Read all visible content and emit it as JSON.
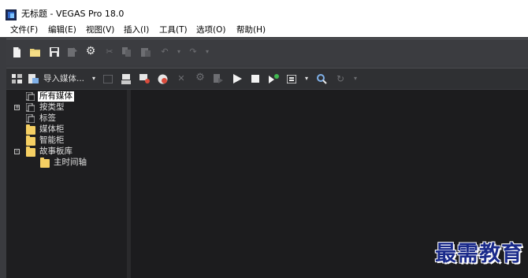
{
  "window": {
    "title": "无标题 - VEGAS Pro 18.0",
    "icon": "vegas-app-icon"
  },
  "menu": [
    {
      "label": "文件(F)"
    },
    {
      "label": "编辑(E)"
    },
    {
      "label": "视图(V)"
    },
    {
      "label": "插入(I)"
    },
    {
      "label": "工具(T)"
    },
    {
      "label": "选项(O)"
    },
    {
      "label": "帮助(H)"
    }
  ],
  "toolbar": {
    "icons": [
      "new-file-icon",
      "open-folder-icon",
      "save-icon",
      "render-as-icon",
      "properties-gear-icon",
      "cut-icon",
      "copy-icon",
      "paste-icon",
      "undo-icon",
      "undo-dropdown-icon",
      "redo-icon",
      "redo-dropdown-icon"
    ]
  },
  "media_toolbar": {
    "import_label": "导入媒体...",
    "icons": [
      "media-view-icon",
      "import-media-icon",
      "import-dropdown-icon",
      "capture-icon",
      "get-media-icon",
      "burn-disc-icon",
      "online-media-icon",
      "remove-icon",
      "effects-icon",
      "apply-media-fx-icon",
      "play-icon",
      "stop-icon",
      "auto-preview-icon",
      "views-icon",
      "views-dropdown-icon",
      "search-media-icon",
      "refresh-icon",
      "refresh-dropdown-icon"
    ]
  },
  "media_tree": {
    "items": [
      {
        "label": "所有媒体",
        "selected": true,
        "icon": "bin-icon"
      },
      {
        "label": "按类型",
        "expander": "+",
        "icon": "bin-icon"
      },
      {
        "label": "标签",
        "icon": "bin-icon"
      },
      {
        "label": "媒体柜",
        "icon": "folder-icon"
      },
      {
        "label": "智能柜",
        "icon": "folder-icon"
      },
      {
        "label": "故事板库",
        "expander": "-",
        "icon": "folder-icon"
      },
      {
        "label": "主时间轴",
        "icon": "folder-icon"
      }
    ]
  },
  "watermark": {
    "text": "最需教育"
  },
  "colors": {
    "toolbar_bg": "#3b3c40",
    "panel_bg": "#1e1e20",
    "watermark": "#1a2a8a",
    "folder": "#f5cf63"
  }
}
